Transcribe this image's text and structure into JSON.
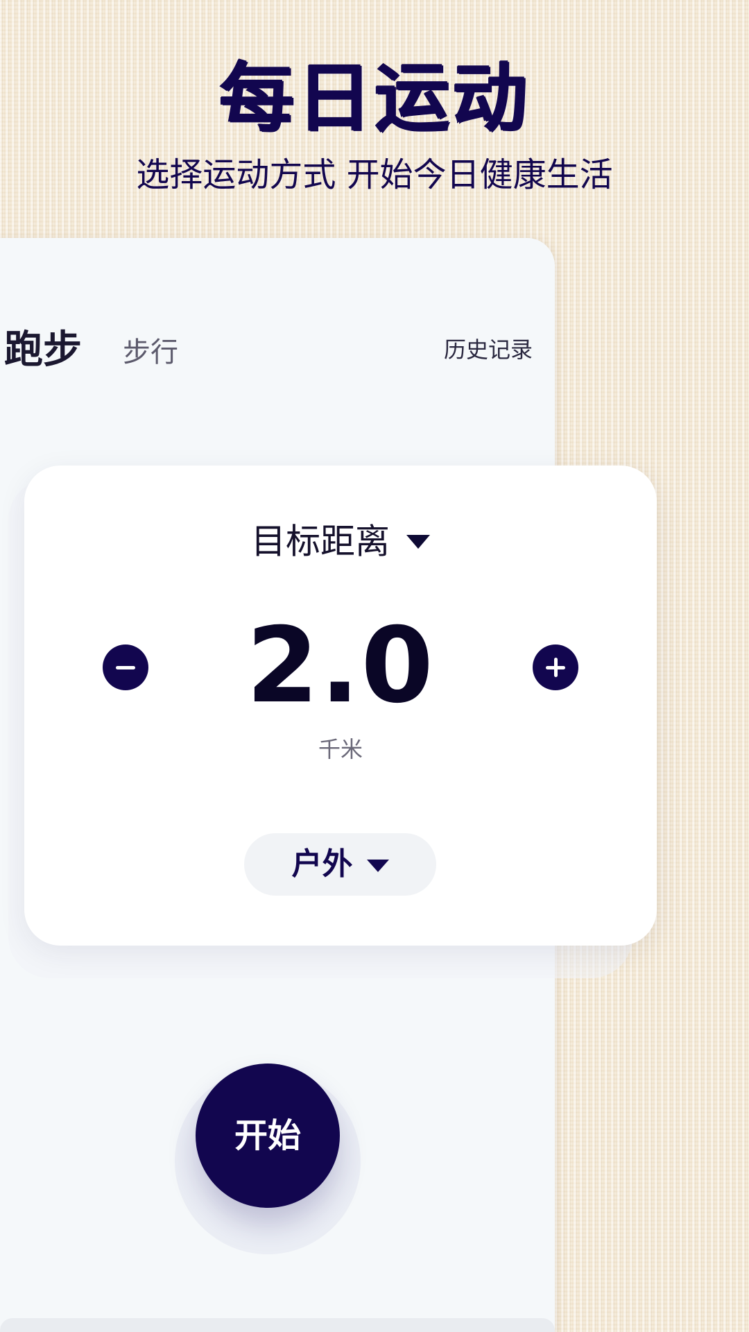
{
  "header": {
    "title": "每日运动",
    "subtitle": "选择运动方式 开始今日健康生活"
  },
  "tabs": [
    {
      "label": "跑步",
      "selected": true
    },
    {
      "label": "步行",
      "selected": false
    }
  ],
  "history_label": "历史记录",
  "goal": {
    "selector_label": "目标距离",
    "selector_icon": "caret-down-icon",
    "value": "2.0",
    "unit": "千米",
    "decrease_icon": "minus-icon",
    "increase_icon": "plus-icon"
  },
  "location": {
    "selected": "户外",
    "icon": "caret-down-icon"
  },
  "start_button_label": "开始",
  "colors": {
    "primary": "#12064f",
    "panel": "#f5f8fa",
    "card": "#ffffff",
    "background": "#f3e6cf"
  }
}
